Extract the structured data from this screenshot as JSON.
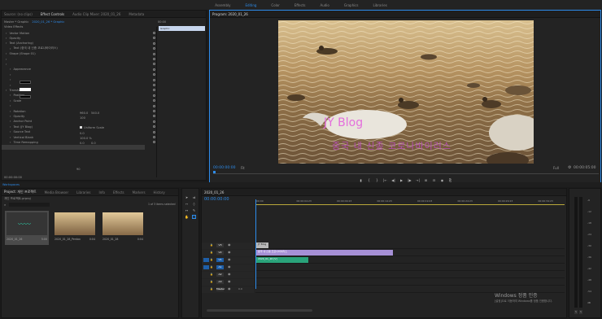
{
  "workspaces": {
    "items": [
      "Assembly",
      "Editing",
      "Color",
      "Effects",
      "Audio",
      "Graphics",
      "Libraries"
    ],
    "active": 1
  },
  "effect_controls": {
    "tabs": [
      "Source: (no clips)",
      "Effect Controls",
      "Audio Clip Mixer: 2020_01_26",
      "Metadata"
    ],
    "active": 1,
    "master_label": "Master * Graphic",
    "clip_label": "2020_01_26 * Graphic",
    "section_title": "Video Effects",
    "rows": [
      "Vector Motion",
      "Opacity",
      "Text (Anchoring)",
      "Text (중국 내 신종 코로나바이러스)",
      "Shape (Shape 01)",
      "",
      "",
      "Appearance",
      "",
      "",
      "",
      "Transform",
      "Position",
      "Scale",
      "",
      "Rotation",
      "Opacity",
      "Anchor Point",
      "Text (JY Blog)",
      "Source Text",
      "Vertical Blank",
      "Time Remapping"
    ],
    "pos_x": "960.0",
    "pos_y": "540.0",
    "scale": "100",
    "rotation": "0.0",
    "opacity": "100.0 %",
    "lock_label": "Uniform Scale",
    "anchor_x": "0.0",
    "anchor_y": "0.0",
    "fill_label": "Fill",
    "stroke_label": "Stroke",
    "font_size": "90",
    "timecode": "00:00:00:00"
  },
  "clip_mini": {
    "timecode": "00:00",
    "clip": "Graphic"
  },
  "program": {
    "title": "Program: 2020_01_26",
    "timecode_left": "00:00:00:00",
    "fit": "Fit",
    "quality": "Full",
    "timecode_right": "00:00:05:00",
    "overlay_title": "JY Blog",
    "overlay_caption": "중국 내 신종 코로나바이러스"
  },
  "project": {
    "tabs": [
      "Project: 개인 프로젝트",
      "Media Browser",
      "Libraries",
      "Info",
      "Effects",
      "Markers",
      "History"
    ],
    "file": "개인 프로젝트.prproj",
    "count": "1 of 3 items selected",
    "items": [
      {
        "name": "2020_01_26",
        "dur": "5:00"
      },
      {
        "name": "2020_01_28_Pentax",
        "dur": "0:04"
      },
      {
        "name": "2020_01_28",
        "dur": "0:04"
      }
    ],
    "status": "Workspaces"
  },
  "timeline": {
    "tab": "2020_01_26",
    "timecode": "00:00:00:00",
    "ruler": [
      "00:00",
      "00:00:04:23",
      "00:00:09:23",
      "00:00:14:23",
      "00:00:19:23",
      "00:00:24:23",
      "00:00:29:23",
      "00:00:34:23"
    ],
    "tracks": [
      "V3",
      "V2",
      "V1",
      "A1",
      "A2",
      "A3",
      "Master"
    ],
    "master_val": "0.0",
    "clips": {
      "v3": "JY Blog",
      "v2": "중국 내 신종 코로나바이러스",
      "v1": "2020_01_26 [V]",
      "a1": "2020_01_26 [A]"
    }
  },
  "watermark": {
    "line1": "Windows 정품 인증",
    "line2": "[설정]으로 이동하여 Windows를 정품 인증합니다."
  },
  "meter": {
    "labels": [
      "-6",
      "-12",
      "-18",
      "-24",
      "-30",
      "-36",
      "-42",
      "-48",
      "-54",
      "dB"
    ],
    "buttons": [
      "S",
      "S"
    ]
  }
}
